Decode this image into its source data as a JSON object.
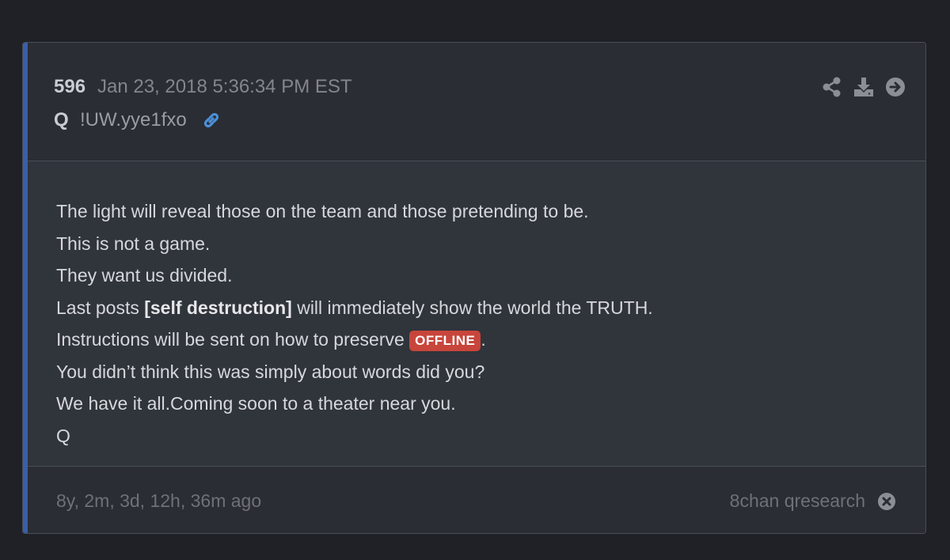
{
  "post": {
    "number": "596",
    "date": "Jan 23, 2018 5:36:34 PM EST",
    "author": "Q",
    "tripcode": "!UW.yye1fxo",
    "icons": {
      "link": "link-icon",
      "share": "share-icon",
      "download": "download-icon",
      "open": "arrow-right-circle-icon",
      "close": "close-circle-icon"
    },
    "colors": {
      "accent": "#3a5fa8",
      "link": "#4a90d9",
      "badge": "#c8453b"
    }
  },
  "body": {
    "line1": "The light will reveal those on the team and those pretending to be.",
    "line2": "This is not a game.",
    "line3": "They want us divided.",
    "line4_pre": "Last posts ",
    "line4_bold": "[self destruction]",
    "line4_post": " will immediately show the world the TRUTH.",
    "line5_pre": "Instructions will be sent on how to preserve ",
    "line5_badge": "OFFLINE",
    "line5_post": ".",
    "line6": "You didn’t think this was simply about words did you?",
    "line7": "We have it all.Coming soon to a theater near you.",
    "line8": "Q"
  },
  "footer": {
    "elapsed": "8y, 2m, 3d, 12h, 36m ago",
    "source": "8chan qresearch"
  }
}
